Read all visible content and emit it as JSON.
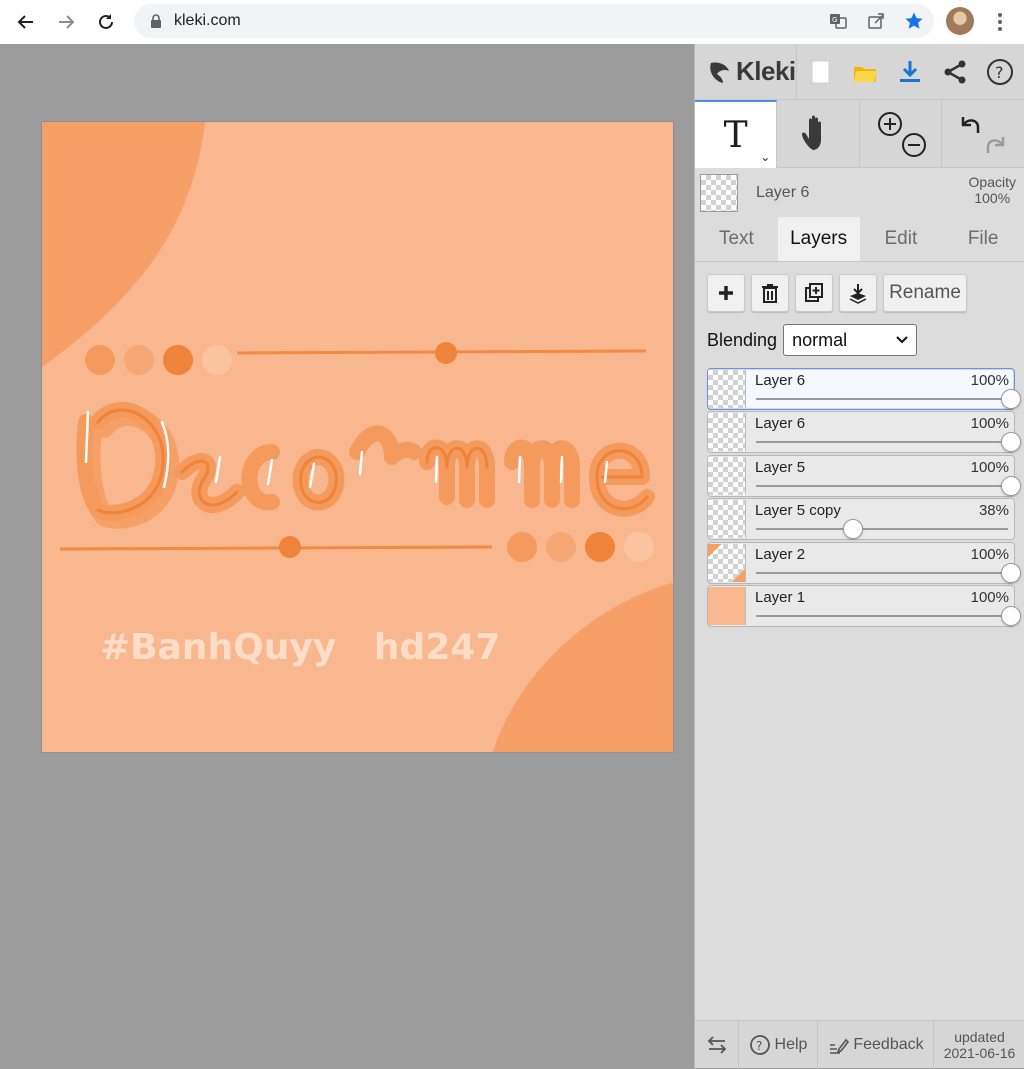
{
  "browser": {
    "url": "kleki.com",
    "icons": [
      "back-icon",
      "forward-icon",
      "reload-icon",
      "lock-icon",
      "translate-icon",
      "share-icon",
      "bookmark-star-icon",
      "profile-avatar",
      "menu-icon"
    ]
  },
  "app": {
    "name": "Kleki",
    "top_icons": [
      "new-image-icon",
      "open-file-icon",
      "download-icon",
      "share-icon",
      "help-icon"
    ],
    "tools": [
      "text-tool",
      "hand-tool",
      "zoom",
      "undo-redo"
    ]
  },
  "artwork": {
    "title_text": "Decorme",
    "hashtag": "#BanhQuyy   hd247",
    "colors": {
      "background": "#f9b78f",
      "accent": "#f39a5c",
      "dark_accent": "#ee8339",
      "light_text": "#fde2cf"
    }
  },
  "layer_info": {
    "name": "Layer 6",
    "opacity_label": "Opacity",
    "opacity_value": "100%"
  },
  "tabs": [
    {
      "label": "Text",
      "active": false
    },
    {
      "label": "Layers",
      "active": true
    },
    {
      "label": "Edit",
      "active": false
    },
    {
      "label": "File",
      "active": false
    }
  ],
  "layer_actions": {
    "rename_label": "Rename",
    "icons": [
      "add-layer-icon",
      "delete-layer-icon",
      "duplicate-layer-icon",
      "merge-down-icon"
    ]
  },
  "blending": {
    "label": "Blending",
    "value": "normal"
  },
  "layers": [
    {
      "name": "Layer 6",
      "opacity": "100%",
      "opacity_fraction": 1.0,
      "selected": true
    },
    {
      "name": "Layer 6",
      "opacity": "100%",
      "opacity_fraction": 1.0,
      "selected": false
    },
    {
      "name": "Layer 5",
      "opacity": "100%",
      "opacity_fraction": 1.0,
      "selected": false
    },
    {
      "name": "Layer 5 copy",
      "opacity": "38%",
      "opacity_fraction": 0.38,
      "selected": false
    },
    {
      "name": "Layer 2",
      "opacity": "100%",
      "opacity_fraction": 1.0,
      "selected": false
    },
    {
      "name": "Layer 1",
      "opacity": "100%",
      "opacity_fraction": 1.0,
      "selected": false
    }
  ],
  "footer": {
    "help_label": "Help",
    "feedback_label": "Feedback",
    "updated_label": "updated",
    "updated_date": "2021-06-16"
  }
}
